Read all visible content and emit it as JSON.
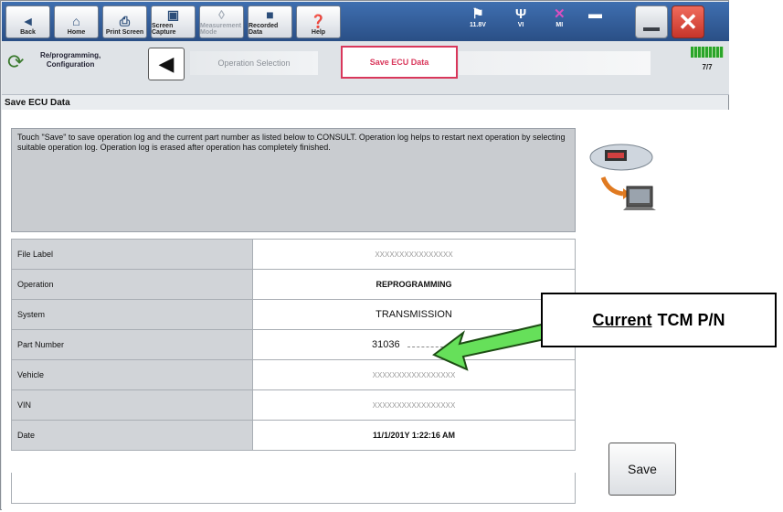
{
  "toolbar": {
    "back_label": "Back",
    "home_label": "Home",
    "print_label": "Print Screen",
    "capture_label": "Screen Capture",
    "measure_label": "Measurement Mode",
    "recorded_label": "Recorded Data",
    "help_label": "Help",
    "voltage": "11.8V",
    "vi_label": "VI",
    "mi_label": "MI"
  },
  "breadcrumb": {
    "mode_label_line1": "Re/programming,",
    "mode_label_line2": "Configuration",
    "step1": "Operation Selection",
    "step2": "Save ECU Data",
    "progress": "7/7"
  },
  "page_title": "Save ECU Data",
  "description": "Touch \"Save\" to save operation log and the current part number as listed below to CONSULT. Operation log helps to restart next operation by selecting suitable operation log. Operation log is erased after operation has completely finished.",
  "table": [
    {
      "key": "File Label",
      "value": "XXXXXXXXXXXXXXXX"
    },
    {
      "key": "Operation",
      "value": "REPROGRAMMING"
    },
    {
      "key": "System",
      "value": "TRANSMISSION"
    },
    {
      "key": "Part Number",
      "value": "31036"
    },
    {
      "key": "Vehicle",
      "value": "XXXXXXXXXXXXXXXXX"
    },
    {
      "key": "VIN",
      "value": "XXXXXXXXXXXXXXXXX"
    },
    {
      "key": "Date",
      "value": "11/1/201Y 1:22:16 AM"
    }
  ],
  "save_button": "Save",
  "annotation": {
    "underlined": "Current",
    "rest": "TCM P/N"
  },
  "colors": {
    "toolbar": "#2a4f86",
    "accent_red": "#d9375b",
    "arrow_green": "#66e05a"
  }
}
